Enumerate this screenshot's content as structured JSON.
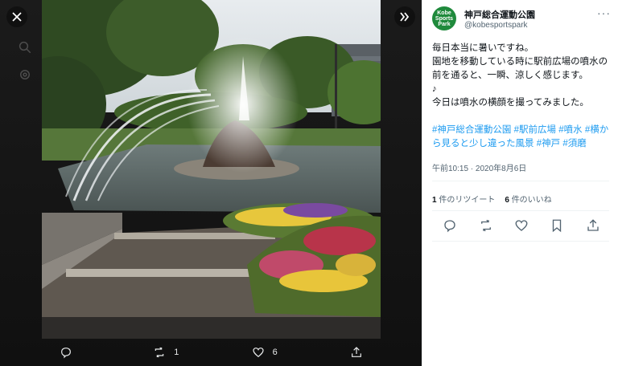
{
  "author": {
    "name": "神戸総合運動公園",
    "handle": "@kobesportspark",
    "avatar_lines": [
      "Kobe",
      "Sports",
      "Park"
    ]
  },
  "tweet": {
    "lines": [
      "毎日本当に暑いですね。",
      "園地を移動している時に駅前広場の噴水の前を通ると、一瞬、涼しく感じます。",
      "♪",
      "今日は噴水の横顔を撮ってみました。"
    ],
    "hashtags": [
      "#神戸総合運動公園",
      "#駅前広場",
      "#噴水",
      "#横から見ると少し違った風景",
      "#神戸",
      "#須磨"
    ],
    "timestamp": "午前10:15 · 2020年8月6日"
  },
  "stats": {
    "retweets_count": "1",
    "retweets_label": "件のリツイート",
    "likes_count": "6",
    "likes_label": "件のいいね"
  },
  "viewer_actions": {
    "reply_count": "",
    "retweet_count": "1",
    "like_count": "6"
  },
  "more_label": "···",
  "colors": {
    "accent": "#1d9bf0",
    "text": "#0f1419",
    "muted": "#536471",
    "avatar": "#1f8a3c"
  }
}
